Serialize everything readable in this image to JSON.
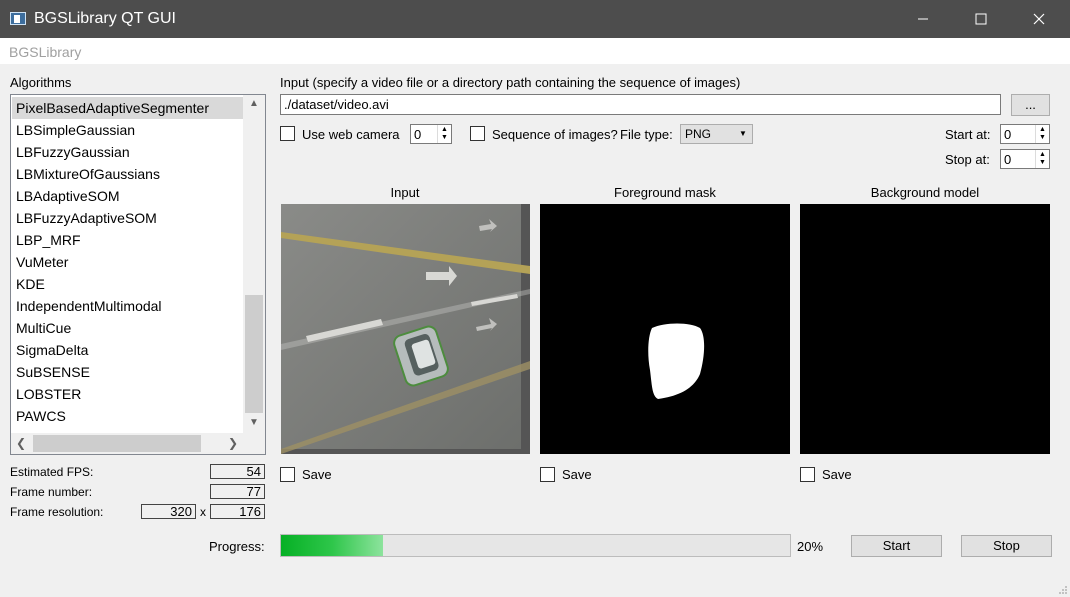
{
  "window": {
    "title": "BGSLibrary QT GUI",
    "menu": [
      "BGSLibrary"
    ]
  },
  "algorithms": {
    "label": "Algorithms",
    "items": [
      "PixelBasedAdaptiveSegmenter",
      "LBSimpleGaussian",
      "LBFuzzyGaussian",
      "LBMixtureOfGaussians",
      "LBAdaptiveSOM",
      "LBFuzzyAdaptiveSOM",
      "LBP_MRF",
      "VuMeter",
      "KDE",
      "IndependentMultimodal",
      "MultiCue",
      "SigmaDelta",
      "SuBSENSE",
      "LOBSTER",
      "PAWCS"
    ],
    "selected_index": 0
  },
  "stats": {
    "fps_label": "Estimated FPS:",
    "fps": "54",
    "frame_number_label": "Frame number:",
    "frame_number": "77",
    "resolution_label": "Frame resolution:",
    "res_w": "320",
    "res_sep": "x",
    "res_h": "176"
  },
  "input": {
    "label": "Input (specify a video file or a directory path containing the sequence of images)",
    "path": "./dataset/video.avi",
    "browse_label": "...",
    "webcam_label": "Use web camera",
    "webcam_checked": false,
    "webcam_index": "0",
    "sequence_label": "Sequence of images?",
    "sequence_checked": false,
    "filetype_label": "File type:",
    "filetype": "PNG",
    "start_label": "Start at:",
    "start_value": "0",
    "stop_label": "Stop at:",
    "stop_value": "0"
  },
  "views": {
    "input_title": "Input",
    "fg_title": "Foreground mask",
    "bg_title": "Background model",
    "save_label": "Save"
  },
  "progress": {
    "label": "Progress:",
    "value": 20,
    "text": "20%",
    "start_label": "Start",
    "stop_label": "Stop"
  }
}
